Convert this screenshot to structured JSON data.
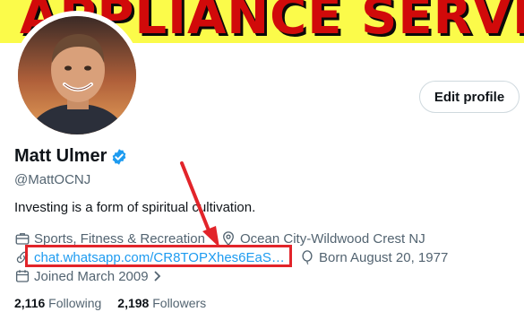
{
  "banner": {
    "text": "APPLIANCE SERVICE",
    "background_color": "#fbfb4a",
    "text_color": "#d10a0a"
  },
  "profile": {
    "display_name": "Matt Ulmer",
    "handle": "@MattOCNJ",
    "bio": "Investing is a form of spiritual cultivation.",
    "verified_icon": "verified-badge-icon",
    "verified_color": "#1d9bf0"
  },
  "actions": {
    "edit_profile_label": "Edit profile"
  },
  "meta": {
    "category": "Sports, Fitness & Recreation",
    "location": "Ocean City-Wildwood Crest NJ",
    "link": "chat.whatsapp.com/CR8TOPXhes6EaS…",
    "birthday": "Born August 20, 1977",
    "joined": "Joined March 2009",
    "icons": {
      "category": "briefcase-icon",
      "location": "location-pin-icon",
      "link": "link-icon",
      "birthday": "balloon-icon",
      "joined": "calendar-icon"
    }
  },
  "stats": {
    "following_count": "2,116",
    "following_label": "Following",
    "followers_count": "2,198",
    "followers_label": "Followers"
  },
  "annotation": {
    "color": "#e2242a"
  }
}
